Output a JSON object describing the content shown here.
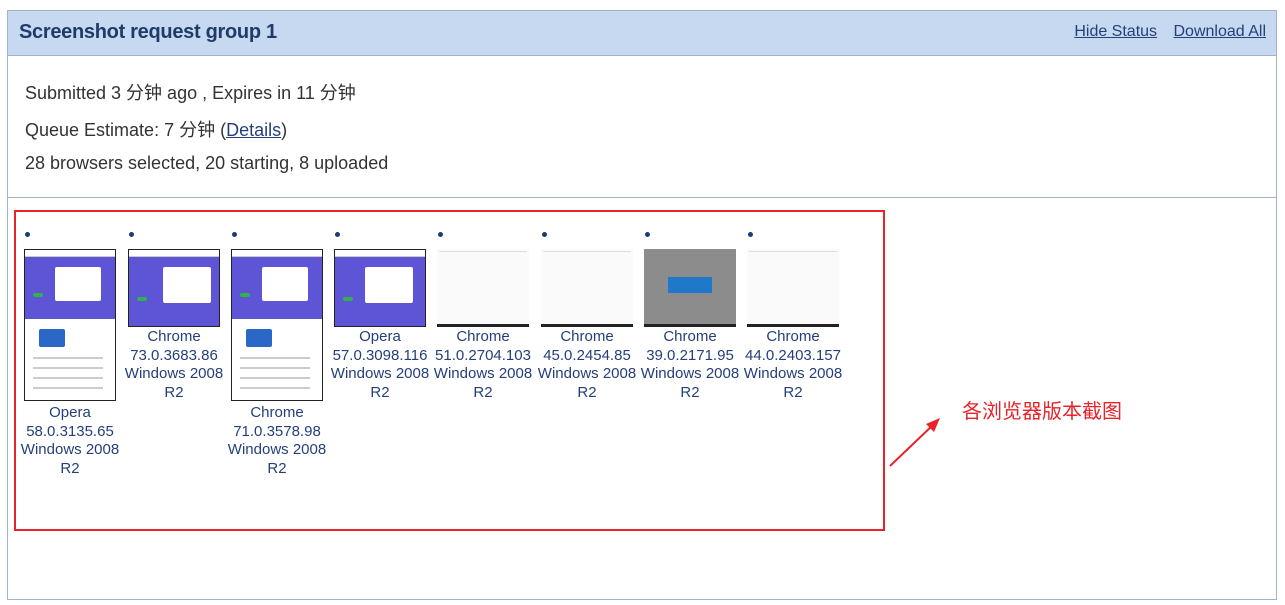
{
  "header": {
    "title": "Screenshot request group 1",
    "hide_status": "Hide Status",
    "download_all": "Download All"
  },
  "status": {
    "submitted": "Submitted 3 分钟 ago , Expires in 11 分钟",
    "queue_prefix": "Queue Estimate: 7 分钟 (",
    "details_link": "Details",
    "queue_suffix": ")",
    "browsers": "28 browsers selected, 20 starting, 8 uploaded"
  },
  "screenshots": [
    {
      "browser": "Opera",
      "version": "58.0.3135.65",
      "os": "Windows 2008",
      "os_ver": "R2"
    },
    {
      "browser": "Chrome",
      "version": "73.0.3683.86",
      "os": "Windows 2008",
      "os_ver": "R2"
    },
    {
      "browser": "Chrome",
      "version": "71.0.3578.98",
      "os": "Windows 2008",
      "os_ver": "R2"
    },
    {
      "browser": "Opera",
      "version": "57.0.3098.116",
      "os": "Windows 2008",
      "os_ver": "R2"
    },
    {
      "browser": "Chrome",
      "version": "51.0.2704.103",
      "os": "Windows 2008",
      "os_ver": "R2"
    },
    {
      "browser": "Chrome",
      "version": "45.0.2454.85",
      "os": "Windows 2008",
      "os_ver": "R2"
    },
    {
      "browser": "Chrome",
      "version": "39.0.2171.95",
      "os": "Windows 2008",
      "os_ver": "R2"
    },
    {
      "browser": "Chrome",
      "version": "44.0.2403.157",
      "os": "Windows 2008",
      "os_ver": "R2"
    }
  ],
  "annotation": {
    "text": "各浏览器版本截图",
    "color": "#e8232a"
  },
  "colors": {
    "header_bg": "#c6d9f1",
    "link": "#243f7a",
    "highlight": "#e8232a"
  }
}
